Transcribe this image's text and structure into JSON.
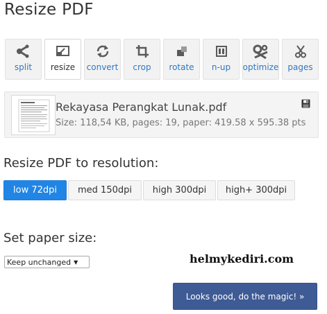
{
  "page_title": "Resize PDF",
  "toolbar": {
    "active": "resize",
    "tools": [
      {
        "label": "split",
        "icon": "split-icon"
      },
      {
        "label": "resize",
        "icon": "resize-icon"
      },
      {
        "label": "convert",
        "icon": "convert-icon"
      },
      {
        "label": "crop",
        "icon": "crop-icon"
      },
      {
        "label": "rotate",
        "icon": "rotate-icon"
      },
      {
        "label": "n-up",
        "icon": "n-up-icon"
      },
      {
        "label": "optimize",
        "icon": "optimize-icon"
      },
      {
        "label": "pages",
        "icon": "scissors-icon"
      }
    ]
  },
  "file": {
    "name": "Rekayasa Perangkat Lunak.pdf",
    "info": "Size: 118,54 KB, pages: 19, paper: 419.58 x 595.38 pts"
  },
  "resolution": {
    "title": "Resize PDF to resolution:",
    "selected": "low 72dpi",
    "options": [
      "low 72dpi",
      "med 150dpi",
      "high 300dpi",
      "high+ 300dpi"
    ]
  },
  "paper": {
    "title": "Set paper size:",
    "selected": "Keep unchanged"
  },
  "watermark": "helmykediri.com",
  "submit_label": "Looks good, do the magic! »",
  "colors": {
    "accent_blue": "#2185e6",
    "submit_bg": "#3f5b95",
    "tool_label": "#2f78c4"
  }
}
